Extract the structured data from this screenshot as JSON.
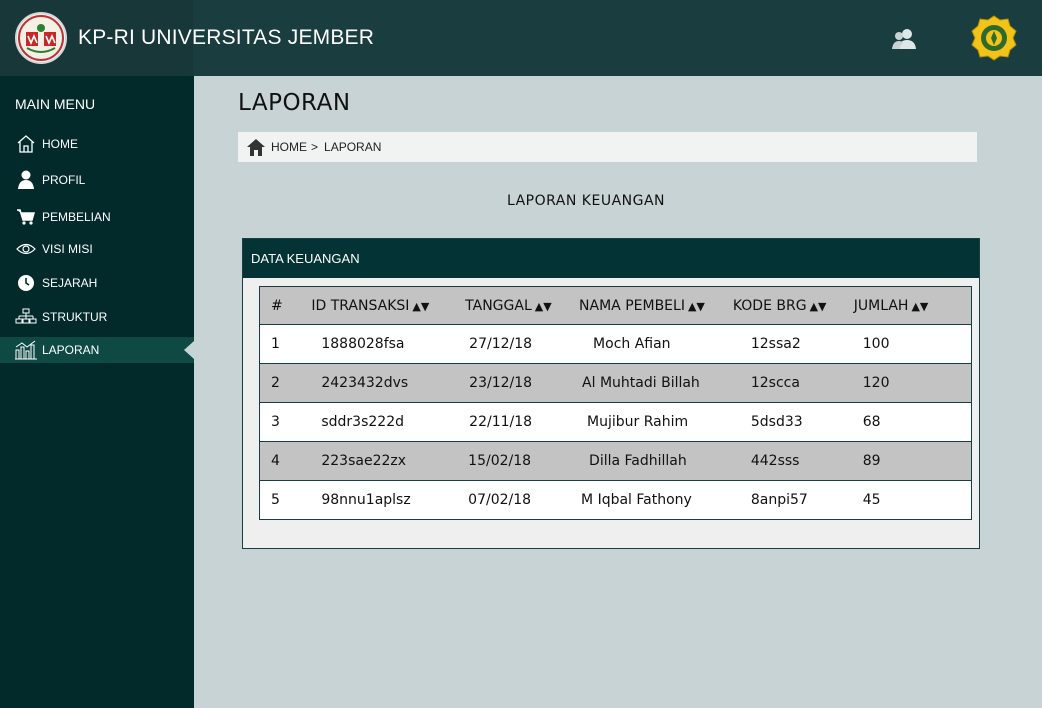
{
  "header": {
    "title": "KP-RI UNIVERSITAS JEMBER"
  },
  "sidebar": {
    "title": "MAIN MENU",
    "items": [
      {
        "label": "HOME",
        "icon": "home-icon"
      },
      {
        "label": "PROFIL",
        "icon": "user-icon"
      },
      {
        "label": "PEMBELIAN",
        "icon": "cart-icon"
      },
      {
        "label": "VISI MISI",
        "icon": "eye-icon"
      },
      {
        "label": "SEJARAH",
        "icon": "clock-icon"
      },
      {
        "label": "STRUKTUR",
        "icon": "org-chart-icon"
      },
      {
        "label": "LAPORAN",
        "icon": "report-chart-icon",
        "active": true
      }
    ]
  },
  "main": {
    "page_title": "LAPORAN",
    "breadcrumb": {
      "home": "HOME",
      "separator": ">",
      "current": "LAPORAN"
    },
    "report_title": "LAPORAN KEUANGAN",
    "panel_title": "DATA KEUANGAN",
    "table": {
      "columns": [
        "#",
        "ID TRANSAKSI",
        "TANGGAL",
        "NAMA PEMBELI",
        "KODE BRG",
        "JUMLAH"
      ],
      "sort_icon": "▲▼",
      "rows": [
        [
          "1",
          "1888028fsa",
          "27/12/18",
          "Moch Afian",
          "12ssa2",
          "100"
        ],
        [
          "2",
          "2423432dvs",
          "23/12/18",
          "Al Muhtadi Billah",
          "12scca",
          "120"
        ],
        [
          "3",
          "sddr3s222d",
          "22/11/18",
          "Mujibur Rahim",
          "5dsd33",
          "68"
        ],
        [
          "4",
          "223sae22zx",
          "15/02/18",
          "Dilla Fadhillah",
          "442sss",
          "89"
        ],
        [
          "5",
          "98nnu1aplsz",
          "07/02/18",
          "M Iqbal Fathony",
          "8anpi57",
          "45"
        ]
      ]
    }
  },
  "colors": {
    "header_bg": "#1a3e40",
    "sidebar_bg": "#022a2b",
    "active_item_bg": "#0e4a43",
    "panel_head_bg": "#033334",
    "content_bg": "#c7d3d4"
  }
}
